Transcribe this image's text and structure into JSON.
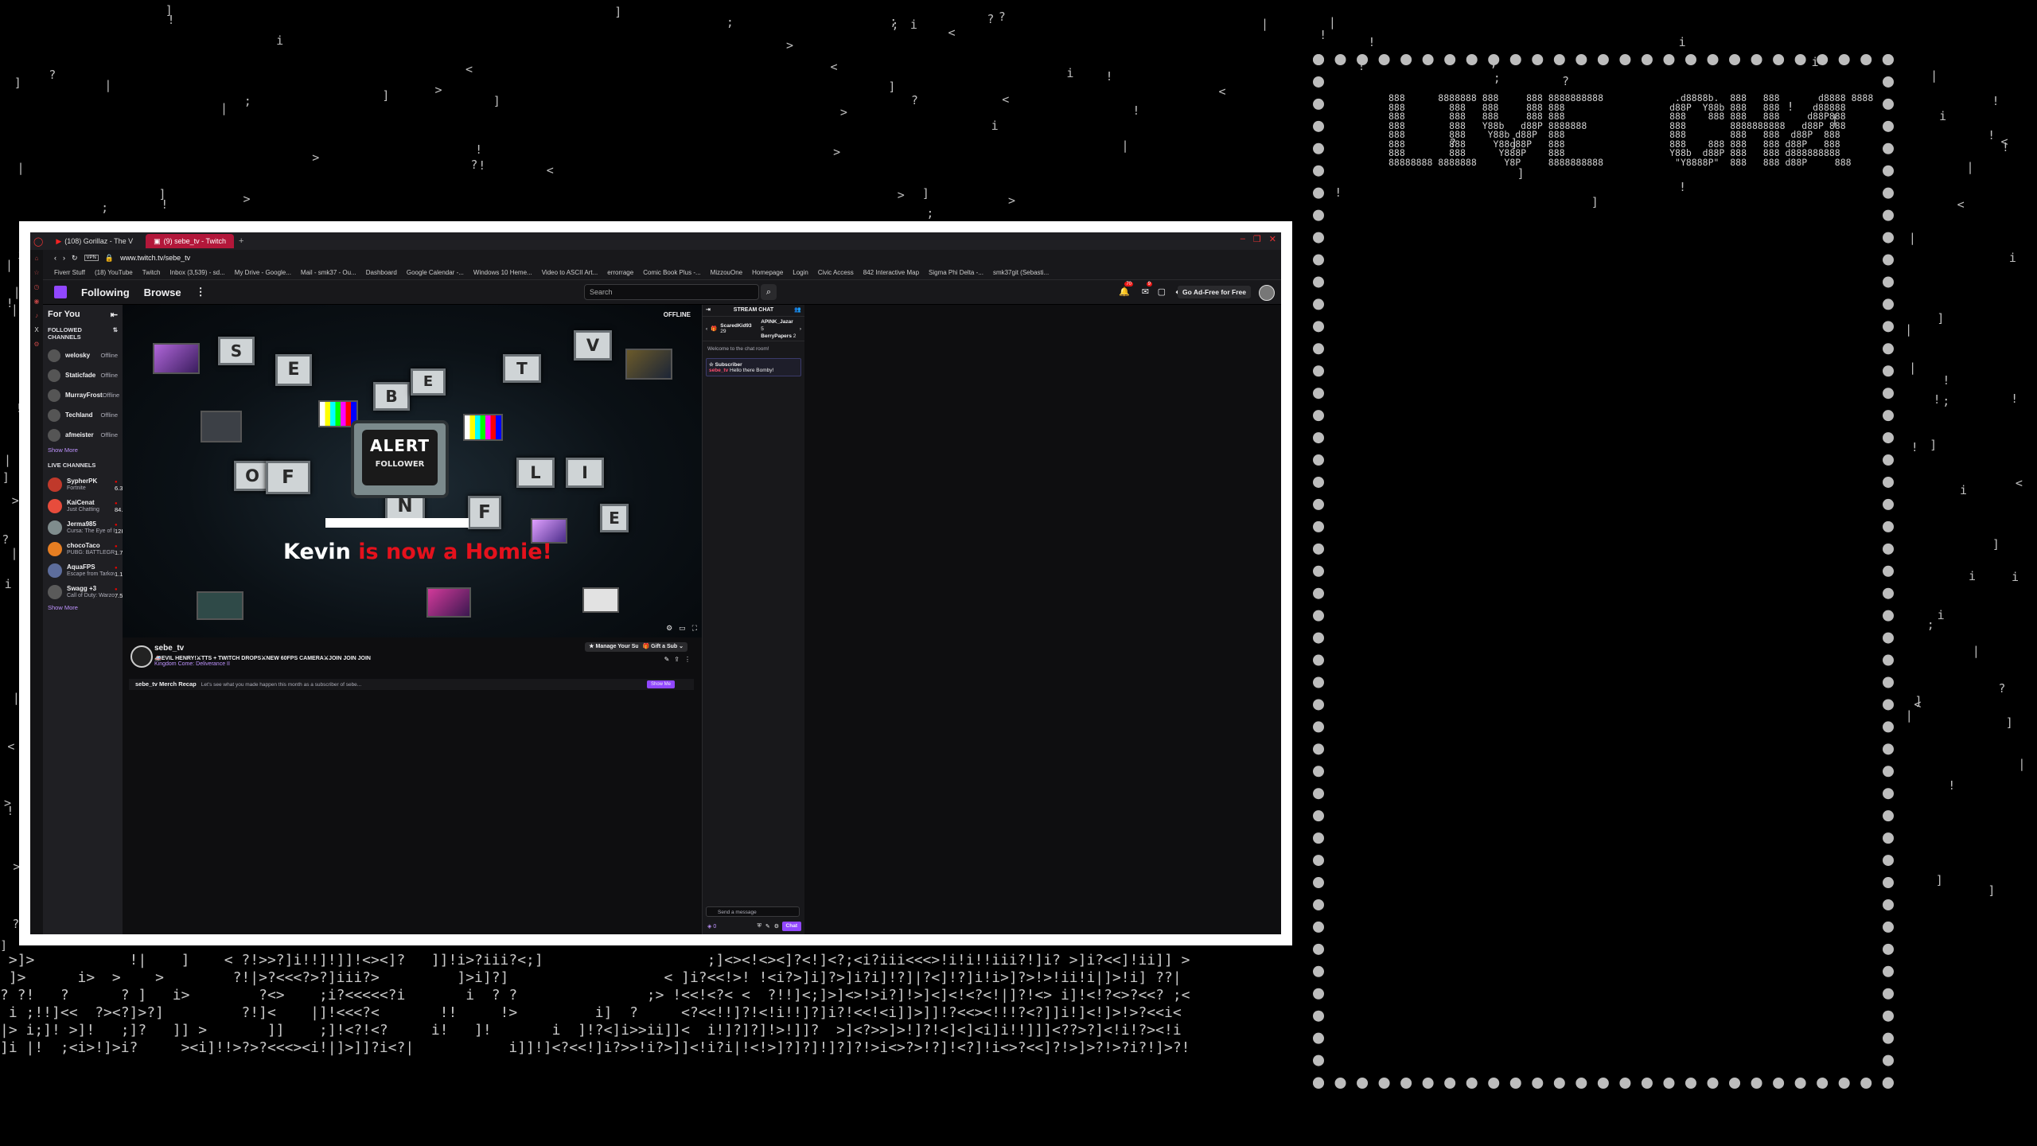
{
  "background": {
    "ascii_logo_lines": [
      "888      8888888 888     888 8888888888             .d8888b.  888   888       d8888 8888",
      "888        888   888     888 888                   d88P  Y88b 888   888      d88888",
      "888        888   888     888 888                   888    888 888   888     d88P888",
      "888        888   Y88b   d88P 8888888               888        8888888888   d88P 888",
      "888        888    Y88b d88P  888                   888        888   888  d88P  888",
      "888        888     Y88o88P   888                   888    888 888   888 d88P   888",
      "888        888      Y888P    888                   Y88b  d88P 888   888 d888888888",
      "88888888 8888888     Y8P     8888888888             \"Y8888P\"  888   888 d88P     888"
    ],
    "ascii_rain_bottom": [
      " >]>           !|    ]    < ?!>>?]i!!]!]]!<><]?   ]]!i>?iii?<;]                   ;]<><!<><]?<!]<?;<i?iii<<<>!i!i!!iii?!]i? >]i?<<]!ii]] >",
      " ]>      i>  >    >        ?!|>?<<<?>?]iii?>         ]>i]?]                  < ]i?<<!>! !<i?>]i]?>]i?i]!?]|?<]!?]i!i>]?>!>!ii!i|]>!i] ??|",
      "? ?!   ?      ? ]   i>        ?<>    ;i?<<<<<?i       i  ? ?               ;> !<<!<?< <  ?!!]<;]>]<>!>i?]!>]<]<!<?<!|]?!<> i]!<!?<>?<<? ;<",
      " i ;!!]<<  ?><?]>?]         ?!]<    |]!<<<?<       !!     !>         i]  ?     <?<<!!]?!<!i!!]?]i?!<<!<i]]>]]!?<<><!!!?<?]]i!]<!]>!>?<<i<",
      "|> i;]! >]!   ;]?   ]] >       ]]    ;]!<?!<?     i!   ]!       i  ]!?<]i>>ii]]<  i!]?]?]!>!]]?  >]<?>>]>!]?!<]<]<i]i!!]]]<??>?]<!i!?><!i",
      "]i |!  ;<i>!]>i?     ><i]!!>?>?<<<><i!|]>]]?i<?|           i]]!]<?<<!]i?>>!i?>]]<!i?i|!<!>]?]?]!]?]?!>i<>?>!?]!<?]!i<>?<<]?!>]>?!>?i?!]>?!"
    ]
  },
  "browser": {
    "tabs": [
      {
        "label": "(108) Gorillaz - The V"
      },
      {
        "label": "(9) sebe_tv - Twitch",
        "active": true
      }
    ],
    "url": "www.twitch.tv/sebe_tv",
    "bookmarks": [
      "Fiverr Stuff",
      "(18) YouTube",
      "Twitch",
      "Inbox (3,539) - sd...",
      "My Drive - Google...",
      "Mail - smk37 - Ou...",
      "Dashboard",
      "Google Calendar -...",
      "Windows 10 Heme...",
      "Video to ASCII Art...",
      "errorrage",
      "Comic Book Plus -...",
      "MizzouOne",
      "Homepage",
      "Login",
      "Civic Access",
      "842 Interactive Map",
      "Sigma Phi Delta -...",
      "smk37git (Sebasti..."
    ]
  },
  "twitch": {
    "nav": {
      "following": "Following",
      "browse": "Browse",
      "search_placeholder": "Search",
      "notif_count": "70",
      "inbox_count": "9",
      "adfree": "Go Ad-Free for Free"
    },
    "sidebar": {
      "for_you": "For You",
      "followed_header": "FOLLOWED CHANNELS",
      "followed": [
        {
          "name": "welosky",
          "status": "Offline"
        },
        {
          "name": "Staticfade",
          "status": "Offline"
        },
        {
          "name": "MurrayFrost",
          "status": "Offline"
        },
        {
          "name": "Techland",
          "status": "Offline"
        },
        {
          "name": "afmeister",
          "status": "Offline"
        }
      ],
      "show_more": "Show More",
      "live_header": "LIVE CHANNELS",
      "live": [
        {
          "name": "SypherPK",
          "game": "Fortnite",
          "viewers": "6.3K"
        },
        {
          "name": "KaiCenat",
          "game": "Just Chatting",
          "viewers": "84.8K"
        },
        {
          "name": "Jerma985",
          "game": "Cursa: The Eye of I...",
          "viewers": "12K"
        },
        {
          "name": "chocoTaco",
          "game": "PUBG: BATTLEGRO...",
          "viewers": "1.7K"
        },
        {
          "name": "AquaFPS",
          "game": "Escape from Tarkov",
          "viewers": "1.1K"
        },
        {
          "name": "Swagg +3",
          "game": "Call of Duty: Warzo...",
          "viewers": "7.5K"
        }
      ],
      "show_more_2": "Show More"
    },
    "player": {
      "offline": "OFFLINE",
      "tv_letters": [
        "S",
        "E",
        "B",
        "E",
        "T",
        "V",
        "O",
        "F",
        "F",
        "L",
        "I",
        "N",
        "E"
      ],
      "alert_title": "ALERT",
      "alert_sub": "FOLLOWER",
      "alert_name": "Kevin",
      "alert_msg": " is now a Homie!"
    },
    "channel": {
      "name": "sebe_tv",
      "title": "🚑EVIL HENRY!⚔TTS + TWITCH DROPS⚔NEW 60FPS CAMERA⚔JOIN JOIN JOIN",
      "game": "Kingdom Come: Deliverance II",
      "manage_sub": "Manage Your Sub",
      "gift_sub": "Gift a Sub",
      "recap_title": "sebe_tv Merch Recap",
      "recap_desc": "Let's see what you made happen this month as a subscriber of sebe...",
      "recap_btn": "Show Me"
    },
    "chat": {
      "header": "STREAM CHAT",
      "gifters": [
        {
          "name": "ScaredKid93",
          "count": "29"
        },
        {
          "name": "APINK_Jazar",
          "count": "5"
        },
        {
          "name": "BerryPapers",
          "count": "2"
        }
      ],
      "welcome": "Welcome to the chat room!",
      "sub_label": "Subscriber",
      "sub_user": "sebe_tv",
      "sub_msg": "Hello there Bomby!",
      "input_placeholder": "Send a message",
      "points": "0",
      "send": "Chat"
    }
  }
}
